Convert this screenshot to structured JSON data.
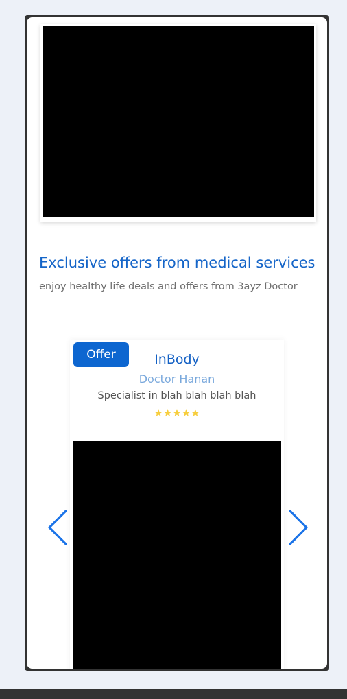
{
  "section": {
    "title": "Exclusive offers from medical services",
    "subtitle": "enjoy healthy life deals and offers from 3ayz Doctor"
  },
  "carousel": {
    "prev_icon": "chevron-left-icon",
    "next_icon": "chevron-right-icon",
    "accent_color": "#1a73e8"
  },
  "offer": {
    "badge": "Offer",
    "title": "InBody",
    "doctor": "Doctor Hanan",
    "specialty": "Specialist in blah blah blah blah",
    "stars_display": "★★★★★",
    "rating": 5,
    "rating_max": 5
  },
  "colors": {
    "brand_blue": "#0d66d0",
    "star": "#f7ce3e",
    "page_bg": "#edf1f8"
  }
}
